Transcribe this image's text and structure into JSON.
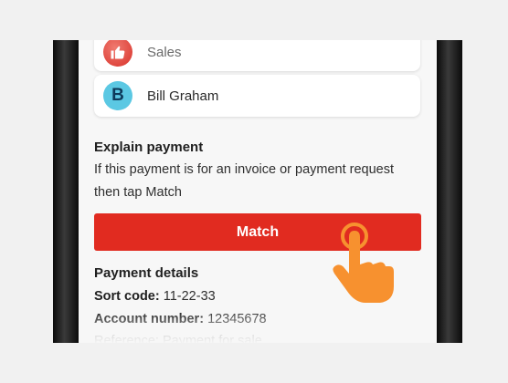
{
  "accounts": [
    {
      "label": "Sales",
      "icon": "thumbs-up-icon"
    },
    {
      "label": "Bill Graham",
      "initial": "B"
    }
  ],
  "explain": {
    "heading": "Explain payment",
    "line1": "If this payment is for an invoice or payment request",
    "line2": "then tap Match"
  },
  "match_button": {
    "label": "Match",
    "color": "#e12b20"
  },
  "payment_details": {
    "heading": "Payment details",
    "sort_code_label": "Sort code:",
    "sort_code_value": "11-22-33",
    "account_number_label": "Account number:",
    "account_number_value": "12345678",
    "reference_label": "Reference:",
    "reference_value": "Payment for sale"
  },
  "tap_hint_icon": "pointing-hand-icon",
  "colors": {
    "accent": "#e12b20",
    "hand": "#f7912f",
    "bill_avatar": "#5bc8e3"
  }
}
